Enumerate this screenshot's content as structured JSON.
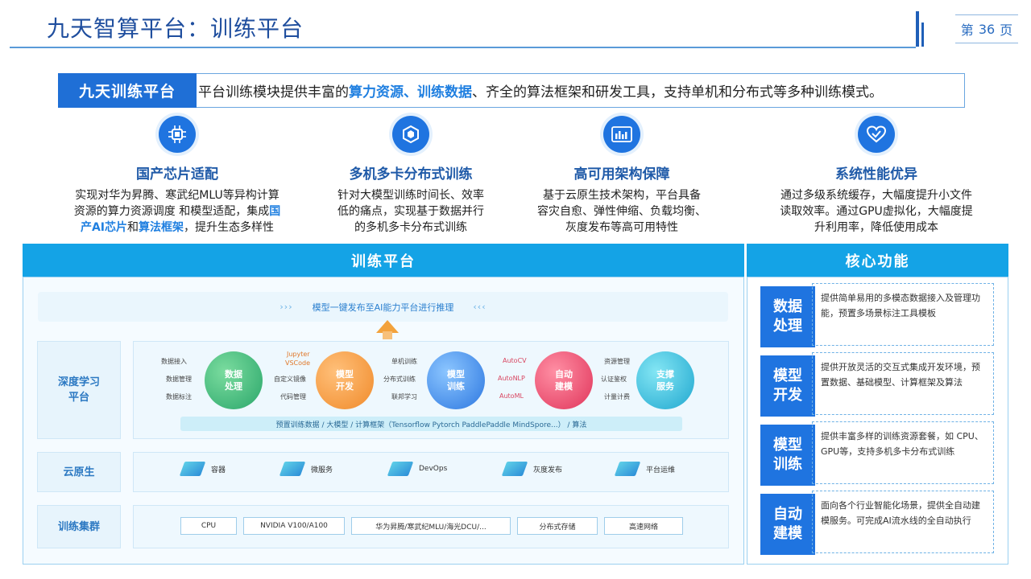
{
  "header": {
    "title": "九天智算平台：训练平台",
    "page_prefix": "第",
    "page_number": "36",
    "page_suffix": "页"
  },
  "banner": {
    "tag": "九天训练平台",
    "text_a": "平台训练模块提供丰富的",
    "hl_1": "算力资源",
    "sep": "、",
    "hl_2": "训练数据",
    "text_b": "、齐全的算法框架和研发工具，支持单机和分布式等多种训练模式。"
  },
  "features": [
    {
      "icon": "chip-icon",
      "title": "国产芯片适配",
      "line1": "实现对华为昇腾、寒武纪MLU等异构计算",
      "line2": "资源的算力资源调度 和模型适配，集成",
      "hl_a": "国",
      "hl_b": "产AI芯片",
      "join": "和",
      "hl_c": "算法框架",
      "tail": "，提升生态多样性"
    },
    {
      "icon": "cube-network-icon",
      "title": "多机多卡分布式训练",
      "line1": "针对大模型训练时间长、效率",
      "line2": "低的痛点，实现基于数据并行",
      "line3": "的多机多卡分布式训练"
    },
    {
      "icon": "server-rack-icon",
      "title": "高可用架构保障",
      "line1": "基于云原生技术架构，平台具备",
      "line2": "容灾自愈、弹性伸缩、负载均衡、",
      "line3": "灰度发布等高可用特性"
    },
    {
      "icon": "heart-check-icon",
      "title": "系统性能优异",
      "line1": "通过多级系统缓存，大幅度提升小文件",
      "line2": "读取效率。通过GPU虚拟化，大幅度提",
      "line3": "升利用率，降低使用成本"
    }
  ],
  "training_platform": {
    "title": "训练平台",
    "top_arrow_left": "›››",
    "top_text": "模型一键发布至AI能力平台进行推理",
    "top_arrow_right": "‹‹‹",
    "rows": {
      "deep_learning": "深度学习平台",
      "dl_line1": "深度学习",
      "dl_line2": "平台",
      "cloud_native": "云原生",
      "cluster": "训练集群"
    },
    "modules": [
      {
        "name": "数据处理",
        "l1": "数据",
        "l2": "处理",
        "items": [
          "数据接入",
          "数据管理",
          "数据标注"
        ]
      },
      {
        "name": "模型开发",
        "l1": "模型",
        "l2": "开发",
        "items": [
          "Jupyter",
          "VSCode",
          "自定义镜像",
          "代码管理"
        ]
      },
      {
        "name": "模型训练",
        "l1": "模型",
        "l2": "训练",
        "items": [
          "单机训练",
          "分布式训练",
          "联邦学习"
        ]
      },
      {
        "name": "自动建模",
        "l1": "自动",
        "l2": "建模",
        "items": [
          "AutoCV",
          "AutoNLP",
          "AutoML"
        ]
      },
      {
        "name": "支撑服务",
        "l1": "支撑",
        "l2": "服务",
        "items": [
          "资源管理",
          "认证鉴权",
          "计量计费"
        ]
      }
    ],
    "strip": "预置训练数据    /    大模型    /    计算框架（Tensorflow Pytorch PaddlePaddle MindSpore...）    /    算法",
    "cloud_items": [
      "容器",
      "微服务",
      "DevOps",
      "灰度发布",
      "平台运维"
    ],
    "hardware": [
      "CPU",
      "NVIDIA V100/A100",
      "华为昇腾/寒武纪MLU/海光DCU/...",
      "分布式存储",
      "高速网络"
    ]
  },
  "core_functions": {
    "title": "核心功能",
    "items": [
      {
        "tag1": "数据",
        "tag2": "处理",
        "desc": "提供简单易用的多模态数据接入及管理功能，预置多场景标注工具模板"
      },
      {
        "tag1": "模型",
        "tag2": "开发",
        "desc": "提供开放灵活的交互式集成开发环境，预置数据、基础模型、计算框架及算法"
      },
      {
        "tag1": "模型",
        "tag2": "训练",
        "desc": "提供丰富多样的训练资源套餐，如 CPU、 GPU等，支持多机多卡分布式训练"
      },
      {
        "tag1": "自动",
        "tag2": "建模",
        "desc": "面向各个行业智能化场景，提供全自动建模服务。可完成AI流水线的全自动执行"
      }
    ]
  },
  "colors": {
    "primary": "#1f74e0",
    "header_blue": "#14a3e6",
    "title_blue": "#1f4e9e",
    "highlight": "#1f7fe0"
  }
}
